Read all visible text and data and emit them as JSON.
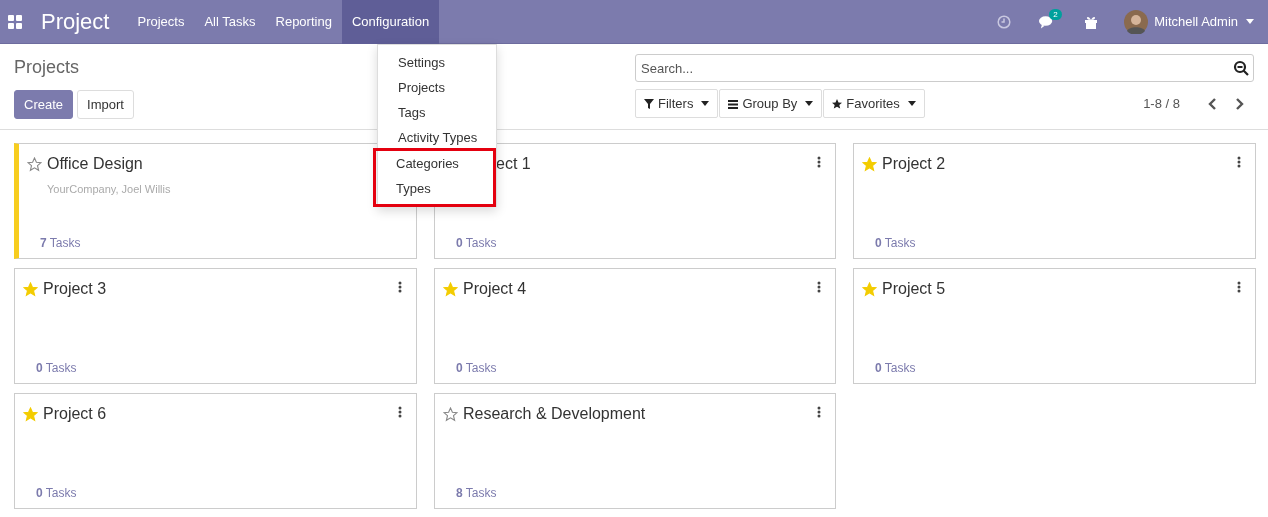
{
  "navbar": {
    "app_title": "Project",
    "menus": [
      {
        "label": "Projects",
        "selected": false
      },
      {
        "label": "All Tasks",
        "selected": false
      },
      {
        "label": "Reporting",
        "selected": false
      },
      {
        "label": "Configuration",
        "selected": true
      }
    ],
    "messages_badge": "2",
    "user_name": "Mitchell Admin"
  },
  "dropdown": {
    "items": [
      {
        "label": "Settings",
        "highlighted": false
      },
      {
        "label": "Projects",
        "highlighted": false
      },
      {
        "label": "Tags",
        "highlighted": false
      },
      {
        "label": "Activity Types",
        "highlighted": false
      },
      {
        "label": "Categories",
        "highlighted": true
      },
      {
        "label": "Types",
        "highlighted": true
      }
    ]
  },
  "control_panel": {
    "breadcrumb": "Projects",
    "buttons": [
      {
        "label": "Create",
        "kind": "primary"
      },
      {
        "label": "Import",
        "kind": "secondary"
      }
    ],
    "search": {
      "placeholder": "Search..."
    },
    "filters": [
      "Filters",
      "Group By",
      "Favorites"
    ],
    "pager": "1-8 / 8"
  },
  "cards": [
    {
      "title": "Office Design",
      "subtitle": "YourCompany, Joel Willis",
      "starred": false,
      "covered": false,
      "color": "#f7cd1f",
      "count": "7",
      "count_label": "Tasks"
    },
    {
      "title": "ect 1",
      "covered": true,
      "count": "0",
      "count_label": "Tasks"
    },
    {
      "title": "Project 2",
      "starred": true,
      "covered": false,
      "count": "0",
      "count_label": "Tasks"
    },
    {
      "title": "Project 3",
      "starred": true,
      "covered": false,
      "count": "0",
      "count_label": "Tasks"
    },
    {
      "title": "Project 4",
      "starred": true,
      "covered": false,
      "count": "0",
      "count_label": "Tasks"
    },
    {
      "title": "Project 5",
      "starred": true,
      "covered": false,
      "count": "0",
      "count_label": "Tasks"
    },
    {
      "title": "Project 6",
      "starred": true,
      "covered": false,
      "count": "0",
      "count_label": "Tasks"
    },
    {
      "title": "Research & Development",
      "starred": false,
      "covered": false,
      "count": "8",
      "count_label": "Tasks"
    }
  ]
}
